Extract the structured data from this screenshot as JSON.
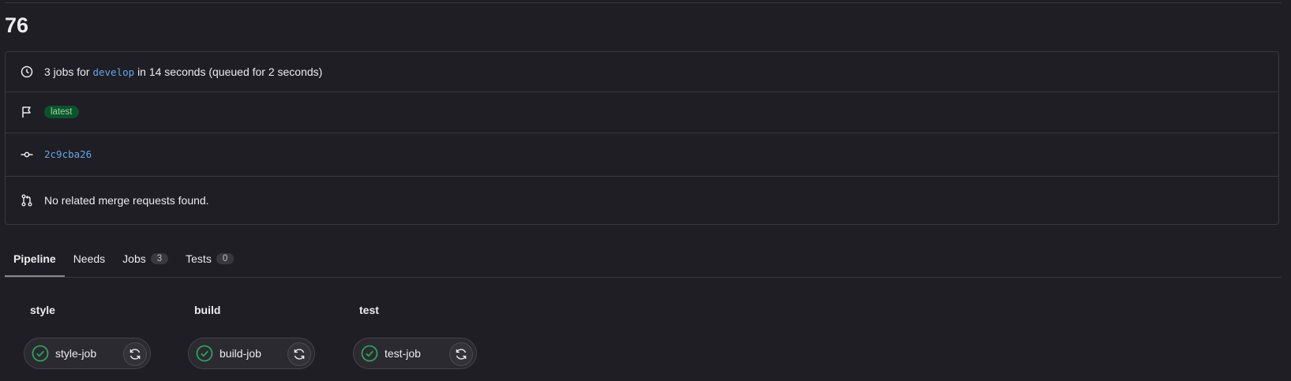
{
  "pipeline": {
    "title": "76",
    "summary": {
      "prefix": "3 jobs for",
      "branch": "develop",
      "suffix": "in 14 seconds (queued for 2 seconds)"
    },
    "badge": "latest",
    "commit": "2c9cba26",
    "merge_requests": "No related merge requests found."
  },
  "tabs": [
    {
      "label": "Pipeline",
      "count": null,
      "active": true
    },
    {
      "label": "Needs",
      "count": null,
      "active": false
    },
    {
      "label": "Jobs",
      "count": "3",
      "active": false
    },
    {
      "label": "Tests",
      "count": "0",
      "active": false
    }
  ],
  "stages": [
    {
      "name": "style",
      "job": {
        "name": "style-job",
        "status": "success"
      }
    },
    {
      "name": "build",
      "job": {
        "name": "build-job",
        "status": "success"
      }
    },
    {
      "name": "test",
      "job": {
        "name": "test-job",
        "status": "success"
      }
    }
  ],
  "icons": {
    "clock": "clock-icon",
    "flag": "flag-icon",
    "commit": "commit-icon",
    "merge_request": "merge-request-icon",
    "status": "check-circle-icon",
    "retry": "retry-icon"
  },
  "colors": {
    "background": "#1f1e24",
    "link": "#63a6e9",
    "success": "#2da160",
    "badge_bg": "#0d532a",
    "badge_text": "#91d4a8"
  }
}
